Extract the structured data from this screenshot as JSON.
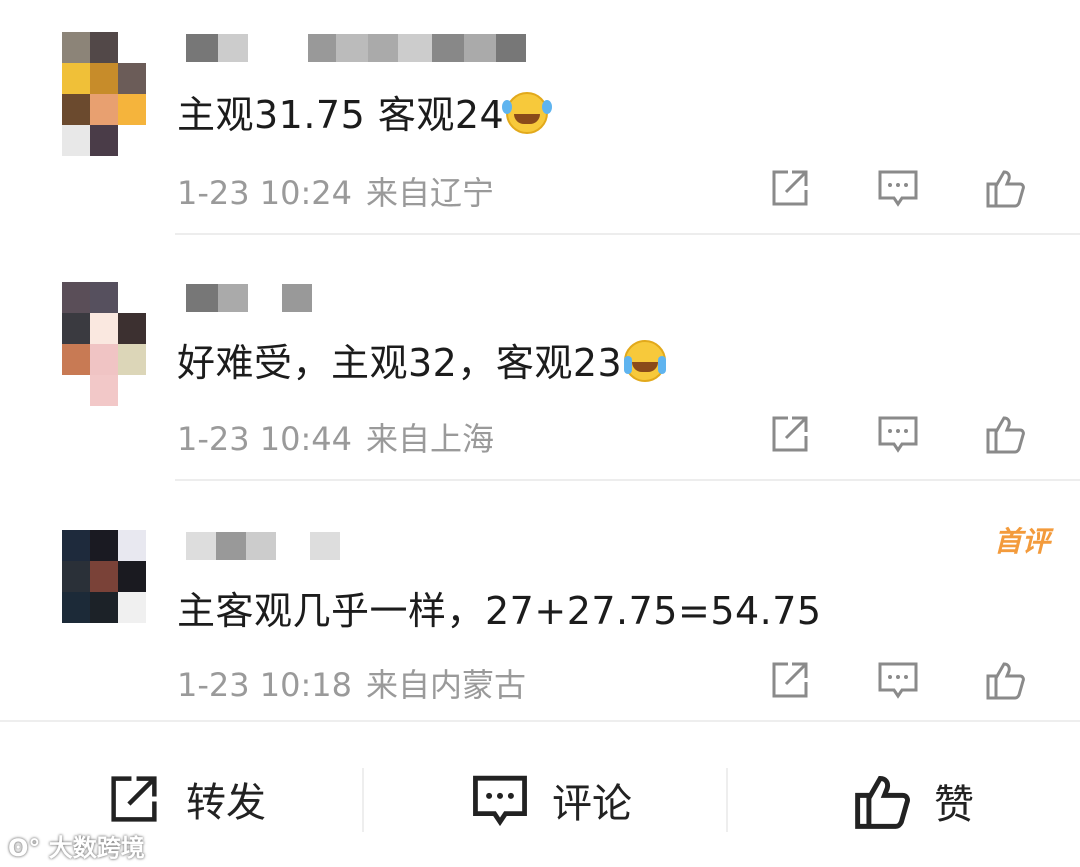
{
  "comments": [
    {
      "text": "主观31.75 客观24",
      "time": "1-23 10:24",
      "location": "来自辽宁",
      "emoji": "laughing-crying-emoji",
      "badge": ""
    },
    {
      "text": "好难受，主观32，客观23",
      "time": "1-23 10:44",
      "location": "来自上海",
      "emoji": "crying-emoji",
      "badge": ""
    },
    {
      "text": "主客观几乎一样，27+27.75=54.75",
      "time": "1-23 10:18",
      "location": "来自内蒙古",
      "emoji": "",
      "badge": "首评"
    }
  ],
  "bottom_bar": {
    "repost_label": "转发",
    "comment_label": "评论",
    "like_label": "赞"
  },
  "watermark": "大数跨境",
  "icons": {
    "share": "share-icon",
    "comment": "comment-icon",
    "like": "thumbs-up-icon"
  },
  "colors": {
    "meta_text": "#9a9a9a",
    "badge": "#f39b3c",
    "icon_stroke": "#8a8a8a"
  }
}
